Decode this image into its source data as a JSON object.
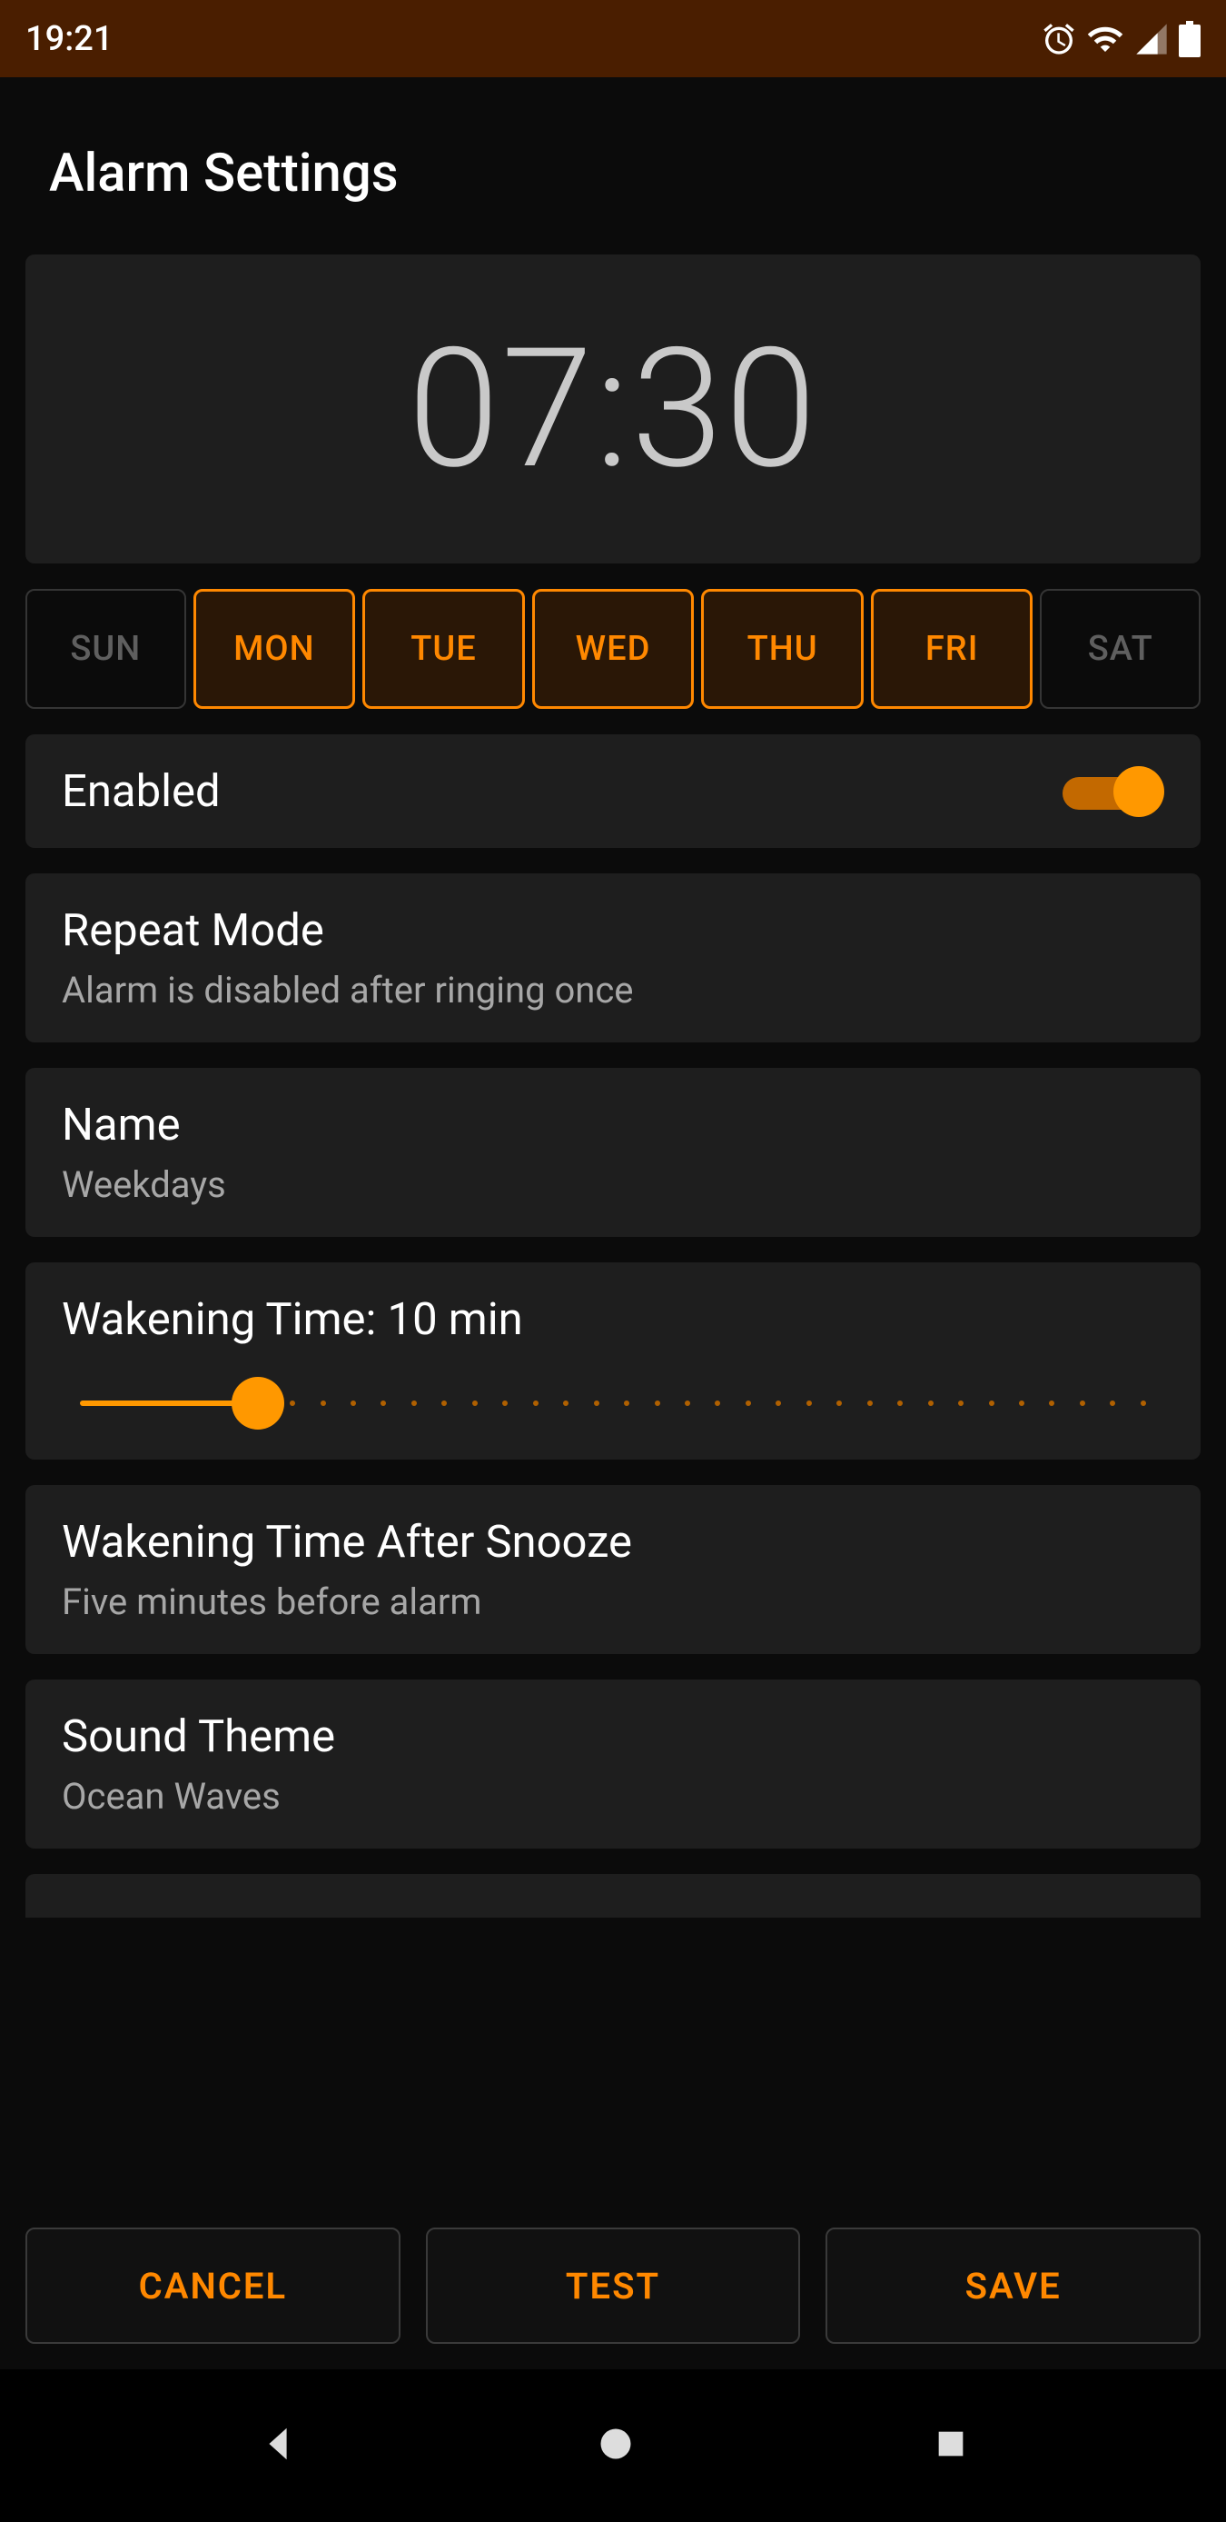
{
  "status": {
    "time": "19:21"
  },
  "title": "Alarm Settings",
  "time": "07:30",
  "days": [
    {
      "label": "SUN",
      "active": false
    },
    {
      "label": "MON",
      "active": true
    },
    {
      "label": "TUE",
      "active": true
    },
    {
      "label": "WED",
      "active": true
    },
    {
      "label": "THU",
      "active": true
    },
    {
      "label": "FRI",
      "active": true
    },
    {
      "label": "SAT",
      "active": false
    }
  ],
  "enabled": {
    "label": "Enabled",
    "value": true
  },
  "repeat": {
    "label": "Repeat Mode",
    "sub": "Alarm is disabled after ringing once"
  },
  "name": {
    "label": "Name",
    "sub": "Weekdays"
  },
  "wakening": {
    "label": "Wakening Time: 10 min",
    "value": 10,
    "max": 60
  },
  "wakening_snooze": {
    "label": "Wakening Time After Snooze",
    "sub": "Five minutes before alarm"
  },
  "sound": {
    "label": "Sound Theme",
    "sub": "Ocean Waves"
  },
  "buttons": {
    "cancel": "CANCEL",
    "test": "TEST",
    "save": "SAVE"
  },
  "accent": "#ff8800"
}
